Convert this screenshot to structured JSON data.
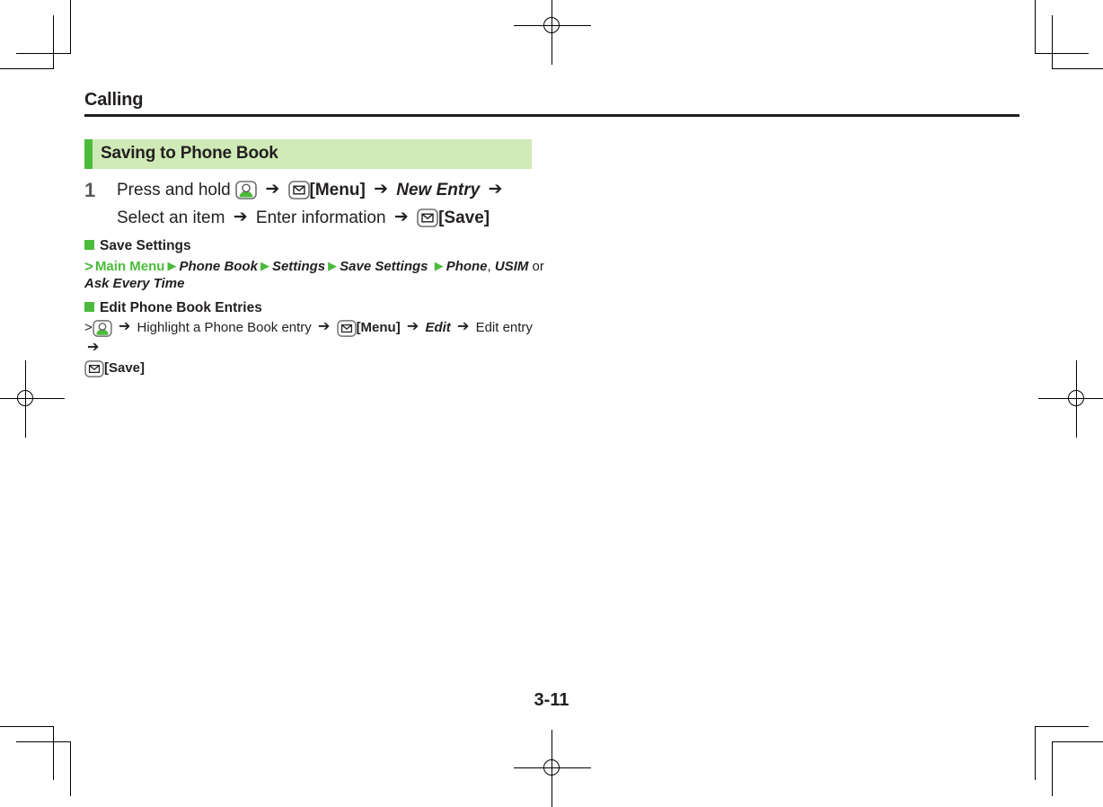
{
  "document": {
    "chapter": "Calling",
    "page_number": "3-11"
  },
  "section": {
    "title": "Saving to Phone Book",
    "accent_color": "#4cbb3c",
    "background_color": "#cfeab6"
  },
  "step": {
    "number": "1",
    "text_1": "Press and hold",
    "icon_1": "contact-key-icon",
    "arrow_1": "➔",
    "icon_2": "mail-key-icon",
    "label_menu": "[Menu]",
    "arrow_2": "➔",
    "emphasis_new_entry": "New Entry",
    "arrow_3": "➔",
    "text_2": "Select an item",
    "arrow_4": "➔",
    "text_3": "Enter information",
    "arrow_5": "➔",
    "icon_3": "mail-key-icon",
    "label_save": "[Save]"
  },
  "subsections": [
    {
      "heading": "Save Settings",
      "nav_prefix": ">",
      "nav_root": "Main Menu",
      "nav_items": [
        "Phone Book",
        "Settings",
        "Save Settings"
      ],
      "nav_line2_items": [
        "Phone",
        "USIM",
        "Ask Every Time"
      ],
      "nav_line2_separator_1": ",",
      "nav_line2_separator_2": "or",
      "triangle": "▶"
    },
    {
      "heading": "Edit Phone Book Entries",
      "nav_prefix": ">",
      "proc": {
        "icon_1": "contact-key-icon",
        "arrow_1": "➔",
        "text_1": "Highlight a Phone Book entry",
        "arrow_2": "➔",
        "icon_2": "mail-key-icon",
        "label_menu": "[Menu]",
        "arrow_3": "➔",
        "emphasis_edit": "Edit",
        "arrow_4": "➔",
        "text_2": "Edit entry",
        "arrow_5": "➔",
        "icon_3": "mail-key-icon",
        "label_save": "[Save]"
      }
    }
  ],
  "print_marks": {
    "registration_mark": "crosshair-circle",
    "corner_marks": "crop-marks"
  }
}
